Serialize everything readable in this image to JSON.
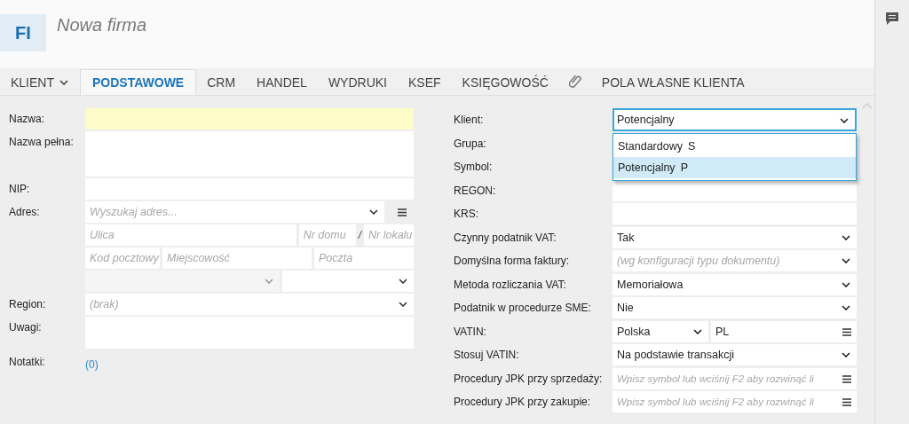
{
  "header": {
    "avatar": "FI",
    "title": "Nowa firma"
  },
  "tabs": [
    {
      "kind": "menu",
      "label": "KLIENT",
      "selected": false
    },
    {
      "kind": "text",
      "label": "PODSTAWOWE",
      "selected": true
    },
    {
      "kind": "text",
      "label": "CRM",
      "selected": false
    },
    {
      "kind": "text",
      "label": "HANDEL",
      "selected": false
    },
    {
      "kind": "text",
      "label": "WYDRUKI",
      "selected": false
    },
    {
      "kind": "text",
      "label": "KSEF",
      "selected": false
    },
    {
      "kind": "text",
      "label": "KSIĘGOWOŚĆ",
      "selected": false
    },
    {
      "kind": "attachment",
      "selected": false
    },
    {
      "kind": "text",
      "label": "POLA WŁASNE KLIENTA",
      "selected": false
    }
  ],
  "left": {
    "name": {
      "label": "Nazwa:",
      "required": true
    },
    "full_name": {
      "label": "Nazwa pełna:"
    },
    "nip": {
      "label": "NIP:"
    },
    "address": {
      "label": "Adres:",
      "search_placeholder": "Wyszukaj adres...",
      "street": "Ulica",
      "house_no": "Nr domu",
      "separator": "/",
      "flat_no": "Nr lokalu",
      "postcode": "Kod pocztowy",
      "city": "Miejscowość",
      "post_office": "Poczta",
      "country_disabled": true
    },
    "region": {
      "label": "Region:",
      "placeholder": "(brak)"
    },
    "notes": {
      "label": "Uwagi:"
    },
    "memos": {
      "label": "Notatki:",
      "count": "(0)"
    }
  },
  "right": [
    {
      "label": "Klient:",
      "kind": "select",
      "value": "Potencjalny",
      "focused": true
    },
    {
      "label": "Grupa:",
      "kind": "covered"
    },
    {
      "label": "Symbol:",
      "kind": "covered"
    },
    {
      "label": "REGON:",
      "kind": "text"
    },
    {
      "label": "KRS:",
      "kind": "text"
    },
    {
      "label": "Czynny podatnik VAT:",
      "kind": "select",
      "value": "Tak",
      "focused": false
    },
    {
      "label": "Domyślna forma faktury:",
      "kind": "select",
      "placeholder": "(wg konfiguracji typu dokumentu)",
      "focused": false
    },
    {
      "label": "Metoda rozliczania VAT:",
      "kind": "select",
      "value": "Memoriałowa",
      "focused": false
    },
    {
      "label": "Podatnik w procedurze SME:",
      "kind": "select",
      "value": "Nie",
      "focused": false
    },
    {
      "label": "VATIN:",
      "kind": "vatin",
      "country": "Polska",
      "code": "PL"
    },
    {
      "label": "Stosuj VATIN:",
      "kind": "select",
      "value": "Na podstawie transakcji",
      "focused": false
    },
    {
      "label": "Procedury JPK przy sprzedaży:",
      "kind": "lookup",
      "placeholder": "Wpisz symbol lub wciśnij F2 aby rozwinąć li"
    },
    {
      "label": "Procedury JPK przy zakupie:",
      "kind": "lookup",
      "placeholder": "Wpisz symbol lub wciśnij F2 aby rozwinąć li"
    }
  ],
  "dropdown": [
    {
      "label": "Standardowy",
      "code": "S",
      "selected": false
    },
    {
      "label": "Potencjalny",
      "code": "P",
      "selected": true
    }
  ]
}
